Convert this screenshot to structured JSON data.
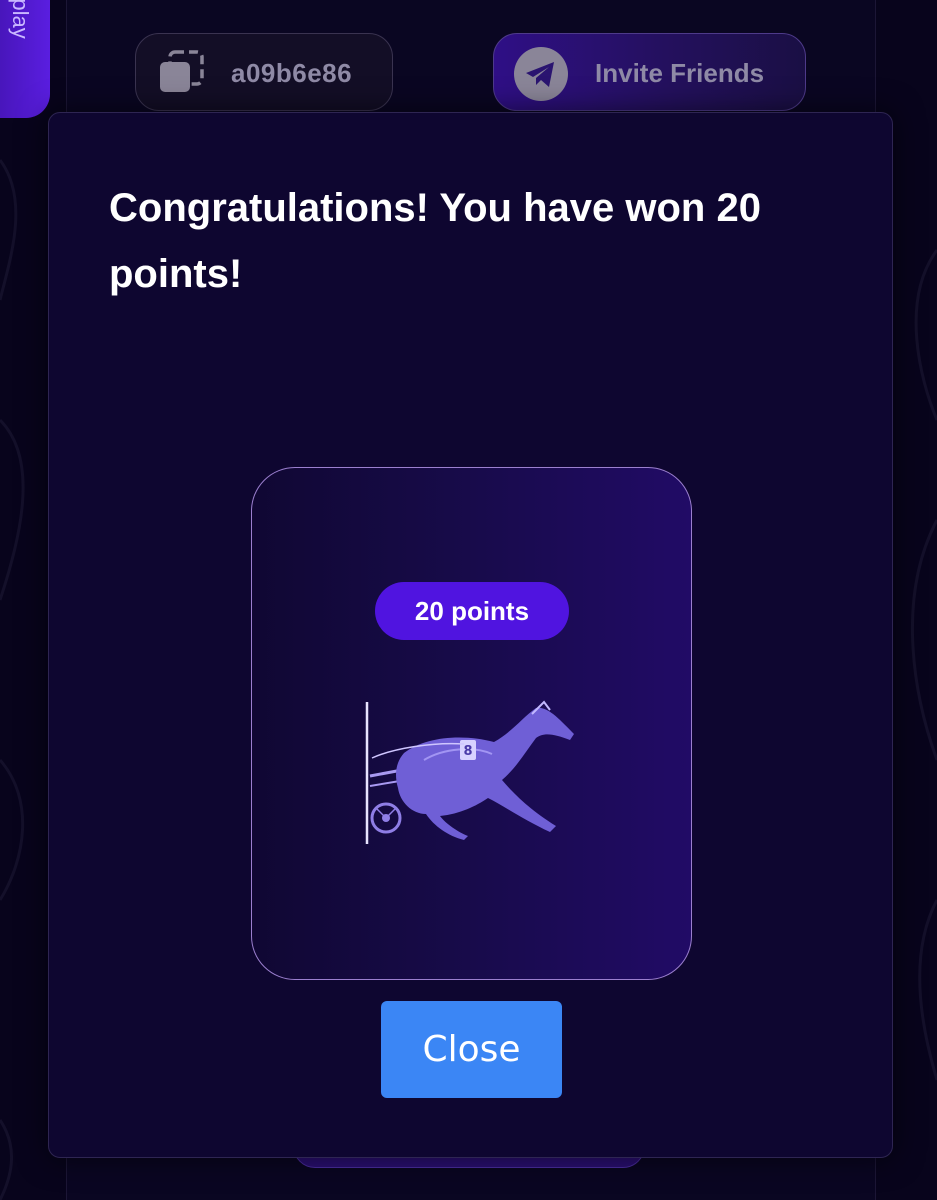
{
  "side_tab": {
    "label": "o play"
  },
  "header": {
    "referral_code": "a09b6e86",
    "copy_icon": "copy-icon",
    "invite_label": "Invite Friends",
    "invite_icon": "telegram-icon"
  },
  "modal": {
    "title": "Congratulations! You have won 20 points!",
    "reward": {
      "badge_label": "20 points",
      "image": "harness-racing-horse-image"
    },
    "close_label": "Close"
  },
  "colors": {
    "background": "#08041c",
    "modal_background": "#0e0630",
    "accent_purple": "#5014e0",
    "card_border": "#9b7fcf",
    "close_button": "#3b86f5",
    "muted_text": "#8f8aa6"
  }
}
